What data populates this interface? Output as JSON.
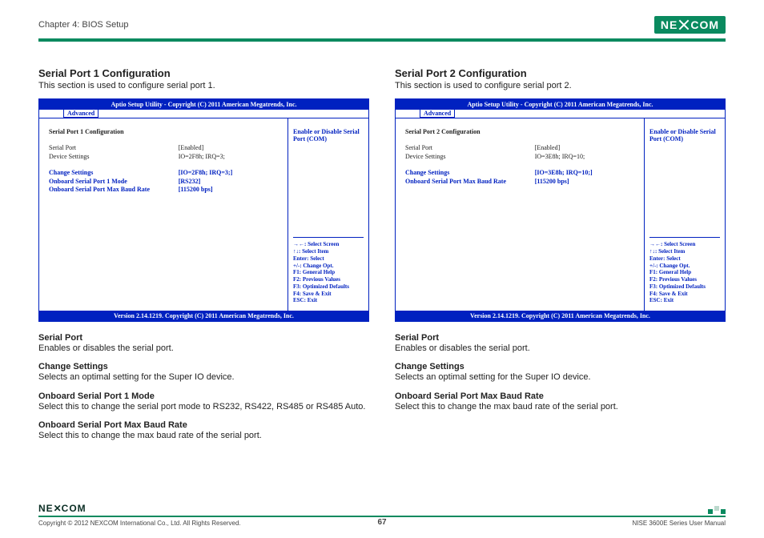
{
  "header": {
    "chapter": "Chapter 4: BIOS Setup",
    "logo_pre": "NE",
    "logo_post": "COM"
  },
  "footer": {
    "logo_pre": "NE",
    "logo_post": "COM",
    "copyright": "Copyright © 2012 NEXCOM International Co., Ltd. All Rights Reserved.",
    "page_num": "67",
    "manual": "NISE 3600E Series User Manual"
  },
  "left": {
    "heading": "Serial Port 1 Configuration",
    "subtext": "This section is used to configure serial port 1.",
    "bios": {
      "titlebar": "Aptio Setup Utility - Copyright (C) 2011 American Megatrends, Inc.",
      "tab": "Advanced",
      "config_title": "Serial Port 1 Configuration",
      "rows": [
        {
          "label": "Serial Port",
          "value": "[Enabled]",
          "cls": "black"
        },
        {
          "label": "Device Settings",
          "value": "IO=2F8h; IRQ=3;",
          "cls": "black bold"
        }
      ],
      "rows_blue": [
        {
          "label": "Change Settings",
          "value": "[IO=2F8h; IRQ=3;]"
        },
        {
          "label": "Onboard Serial Port 1 Mode",
          "value": "[RS232]"
        },
        {
          "label": "Onboard Serial Port Max Baud Rate",
          "value": "[115200 bps]"
        }
      ],
      "help": "Enable or Disable Serial Port (COM)",
      "keys": [
        "→←: Select Screen",
        "↑↓: Select Item",
        "Enter: Select",
        "+/-: Change Opt.",
        "F1: General Help",
        "F2: Previous Values",
        "F3: Optimized Defaults",
        "F4: Save & Exit",
        "ESC: Exit"
      ],
      "footer": "Version 2.14.1219. Copyright (C) 2011 American Megatrends, Inc."
    },
    "descriptions": [
      {
        "title": "Serial Port",
        "text": "Enables or disables the serial port."
      },
      {
        "title": "Change Settings",
        "text": "Selects an optimal setting for the Super IO device."
      },
      {
        "title": "Onboard Serial Port 1 Mode",
        "text": "Select this to change the serial port mode to RS232, RS422, RS485 or RS485 Auto."
      },
      {
        "title": "Onboard Serial Port Max Baud Rate",
        "text": "Select this to change the max baud rate of the serial port."
      }
    ]
  },
  "right": {
    "heading": "Serial Port 2 Configuration",
    "subtext": "This section is used to configure serial port 2.",
    "bios": {
      "titlebar": "Aptio Setup Utility - Copyright (C) 2011 American Megatrends, Inc.",
      "tab": "Advanced",
      "config_title": "Serial Port 2 Configuration",
      "rows": [
        {
          "label": "Serial Port",
          "value": "[Enabled]",
          "cls": "black"
        },
        {
          "label": "Device Settings",
          "value": "IO=3E8h; IRQ=10;",
          "cls": "black bold"
        }
      ],
      "rows_blue": [
        {
          "label": "Change Settings",
          "value": "[IO=3E8h; IRQ=10;]"
        },
        {
          "label": "Onboard Serial Port Max Baud Rate",
          "value": "[115200 bps]"
        }
      ],
      "help": "Enable or Disable Serial Port (COM)",
      "keys": [
        "→←: Select Screen",
        "↑↓: Select Item",
        "Enter: Select",
        "+/-: Change Opt.",
        "F1: General Help",
        "F2: Previous Values",
        "F3: Optimized Defaults",
        "F4: Save & Exit",
        "ESC: Exit"
      ],
      "footer": "Version 2.14.1219. Copyright (C) 2011 American Megatrends, Inc."
    },
    "descriptions": [
      {
        "title": "Serial Port",
        "text": "Enables or disables the serial port."
      },
      {
        "title": "Change Settings",
        "text": "Selects an optimal setting for the Super IO device."
      },
      {
        "title": "Onboard Serial Port Max Baud Rate",
        "text": "Select this to change the max baud rate of the serial port."
      }
    ]
  }
}
